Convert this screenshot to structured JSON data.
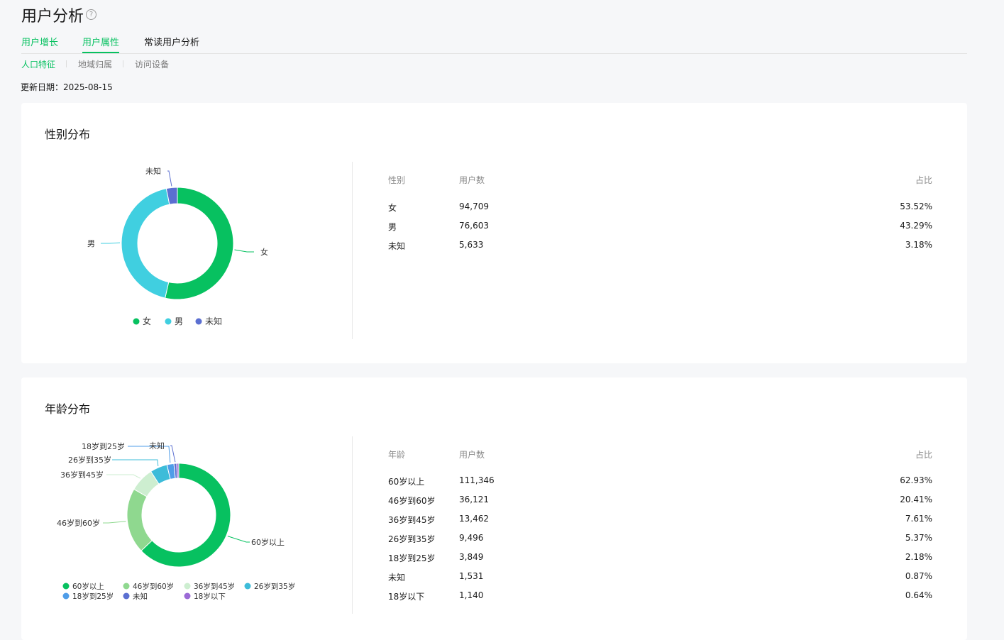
{
  "page": {
    "title": "用户分析",
    "help_icon": "question-circle-icon"
  },
  "tabs": [
    {
      "label": "用户增长"
    },
    {
      "label": "用户属性"
    },
    {
      "label": "常读用户分析"
    }
  ],
  "sub_tabs": [
    {
      "label": "人口特征"
    },
    {
      "label": "地域归属"
    },
    {
      "label": "访问设备"
    }
  ],
  "update": {
    "label": "更新日期：",
    "date": "2025-08-15"
  },
  "gender": {
    "title": "性别分布",
    "headers": {
      "name": "性别",
      "users": "用户数",
      "ratio": "占比"
    },
    "rows": [
      {
        "name": "女",
        "users": "94,709",
        "ratio": "53.52%"
      },
      {
        "name": "男",
        "users": "76,603",
        "ratio": "43.29%"
      },
      {
        "name": "未知",
        "users": "5,633",
        "ratio": "3.18%"
      }
    ]
  },
  "age": {
    "title": "年龄分布",
    "headers": {
      "name": "年龄",
      "users": "用户数",
      "ratio": "占比"
    },
    "rows": [
      {
        "name": "60岁以上",
        "users": "111,346",
        "ratio": "62.93%"
      },
      {
        "name": "46岁到60岁",
        "users": "36,121",
        "ratio": "20.41%"
      },
      {
        "name": "36岁到45岁",
        "users": "13,462",
        "ratio": "7.61%"
      },
      {
        "name": "26岁到35岁",
        "users": "9,496",
        "ratio": "5.37%"
      },
      {
        "name": "18岁到25岁",
        "users": "3,849",
        "ratio": "2.18%"
      },
      {
        "name": "未知",
        "users": "1,531",
        "ratio": "0.87%"
      },
      {
        "name": "18岁以下",
        "users": "1,140",
        "ratio": "0.64%"
      }
    ]
  },
  "chart_data": [
    {
      "type": "pie",
      "donut": true,
      "categories": [
        "女",
        "男",
        "未知"
      ],
      "values": [
        94709,
        76603,
        5633
      ],
      "colors": [
        "#07c160",
        "#40cfe0",
        "#5b6fd1"
      ],
      "legend_position": "bottom"
    },
    {
      "type": "pie",
      "donut": true,
      "categories": [
        "60岁以上",
        "46岁到60岁",
        "36岁到45岁",
        "26岁到35岁",
        "18岁到25岁",
        "未知",
        "18岁以下"
      ],
      "values": [
        111346,
        36121,
        13462,
        9496,
        3849,
        1531,
        1140
      ],
      "colors": [
        "#07c160",
        "#8fd88f",
        "#cdeed0",
        "#3dbcd9",
        "#4f9de8",
        "#5b6fd1",
        "#9b6ad6"
      ],
      "legend_position": "bottom"
    }
  ]
}
